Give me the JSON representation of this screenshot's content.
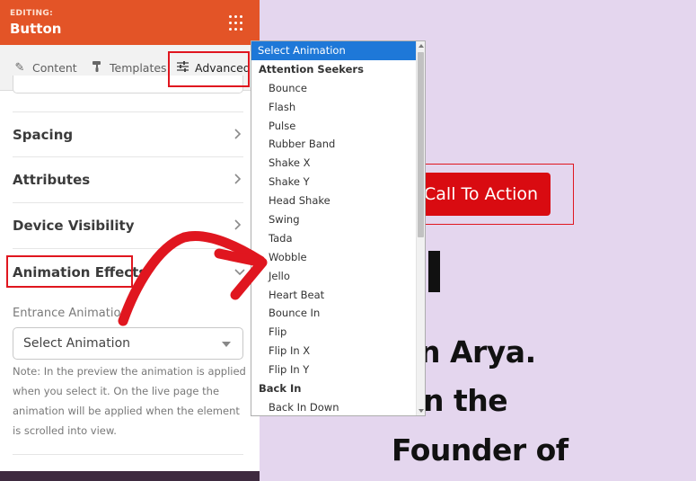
{
  "panel": {
    "editing_label": "EDITING:",
    "title": "Button",
    "menu_icon": "dots-grid-icon",
    "accent_color": "#e35427"
  },
  "tabs": [
    {
      "label": "Content",
      "icon": "pencil-icon"
    },
    {
      "label": "Templates",
      "icon": "paint-roller-icon"
    },
    {
      "label": "Advanced",
      "icon": "sliders-icon",
      "active": true
    }
  ],
  "sections": [
    {
      "label": "Spacing",
      "icon": "chevron-right-icon"
    },
    {
      "label": "Attributes",
      "icon": "chevron-right-icon"
    },
    {
      "label": "Device Visibility",
      "icon": "chevron-right-icon"
    },
    {
      "label": "Animation Effects",
      "icon": "chevron-down-icon"
    }
  ],
  "animation": {
    "entrance_label": "Entrance Animation",
    "select_value": "Select Animation",
    "note": "Note: In the preview the animation is applied when you select it. On the live page the animation will be applied when the element is scrolled into view."
  },
  "dropdown": {
    "selected": "Select Animation",
    "group_attention": "Attention Seekers",
    "attention_items": [
      "Bounce",
      "Flash",
      "Pulse",
      "Rubber Band",
      "Shake X",
      "Shake Y",
      "Head Shake",
      "Swing",
      "Tada",
      "Wobble",
      "Jello",
      "Heart Beat",
      "Bounce In",
      "Flip",
      "Flip In X",
      "Flip In Y"
    ],
    "group_back": "Back In",
    "back_items": [
      "Back In Down"
    ],
    "highlight_color": "#1e78d8"
  },
  "preview": {
    "cta_label": "Call To Action",
    "cta_color": "#d90b11",
    "line1": "n Arya.",
    "line2": "n the",
    "line3": "Founder of",
    "background": "#e4d6ee"
  },
  "annotation_color": "#e0161f"
}
